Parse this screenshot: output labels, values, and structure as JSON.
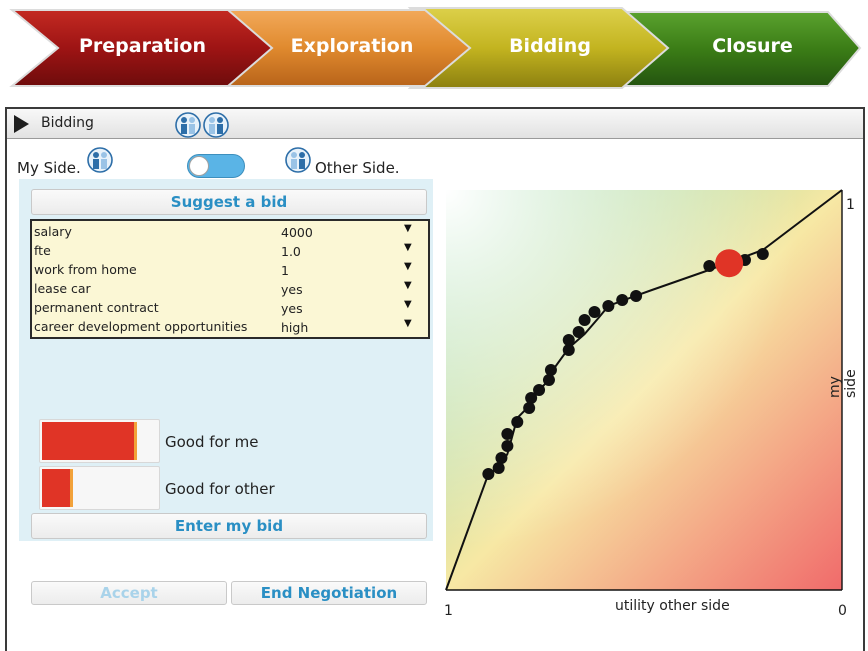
{
  "stages": [
    {
      "label": "Preparation",
      "color": "#a01818"
    },
    {
      "label": "Exploration",
      "color": "#e08a2e"
    },
    {
      "label": "Bidding",
      "color": "#c3b420"
    },
    {
      "label": "Closure",
      "color": "#3b7d16"
    }
  ],
  "panel": {
    "title": "Bidding",
    "my_side_label": "My Side.",
    "other_side_label": "Other Side.",
    "suggest_button": "Suggest a bid",
    "enter_button": "Enter my bid",
    "accept_button": "Accept",
    "end_button": "End Negotiation"
  },
  "issues": [
    {
      "name": "salary",
      "value": "4000"
    },
    {
      "name": "fte",
      "value": "1.0"
    },
    {
      "name": "work from home",
      "value": "1"
    },
    {
      "name": "lease car",
      "value": "yes"
    },
    {
      "name": "permanent contract",
      "value": "yes"
    },
    {
      "name": "career development opportunities",
      "value": "high"
    }
  ],
  "meters": {
    "good_for_me": {
      "label": "Good for me",
      "fraction": 0.83
    },
    "good_for_other": {
      "label": "Good for other",
      "fraction": 0.27
    }
  },
  "chart": {
    "xlabel": "utility other side",
    "ylabel": "my side",
    "x_left_tick": "1",
    "x_right_tick": "0",
    "y_top_tick": "1"
  },
  "chart_data": {
    "type": "scatter",
    "xlabel": "utility other side",
    "ylabel": "my side",
    "x_axis_direction": "reversed",
    "xlim": [
      1,
      0
    ],
    "ylim": [
      0,
      1
    ],
    "frontier": [
      [
        1.0,
        0.0
      ],
      [
        0.893,
        0.29
      ],
      [
        0.867,
        0.305
      ],
      [
        0.845,
        0.34
      ],
      [
        0.82,
        0.43
      ],
      [
        0.79,
        0.46
      ],
      [
        0.765,
        0.5
      ],
      [
        0.74,
        0.525
      ],
      [
        0.73,
        0.55
      ],
      [
        0.69,
        0.605
      ],
      [
        0.65,
        0.64
      ],
      [
        0.615,
        0.68
      ],
      [
        0.59,
        0.71
      ],
      [
        0.55,
        0.725
      ],
      [
        0.48,
        0.75
      ],
      [
        0.35,
        0.795
      ],
      [
        0.2,
        0.85
      ],
      [
        0.0,
        1.0
      ]
    ],
    "bids": [
      [
        0.893,
        0.29
      ],
      [
        0.867,
        0.305
      ],
      [
        0.86,
        0.33
      ],
      [
        0.845,
        0.36
      ],
      [
        0.845,
        0.39
      ],
      [
        0.82,
        0.42
      ],
      [
        0.79,
        0.455
      ],
      [
        0.785,
        0.48
      ],
      [
        0.765,
        0.5
      ],
      [
        0.74,
        0.525
      ],
      [
        0.735,
        0.55
      ],
      [
        0.69,
        0.6
      ],
      [
        0.69,
        0.625
      ],
      [
        0.665,
        0.645
      ],
      [
        0.65,
        0.675
      ],
      [
        0.625,
        0.695
      ],
      [
        0.59,
        0.71
      ],
      [
        0.555,
        0.725
      ],
      [
        0.52,
        0.735
      ],
      [
        0.335,
        0.81
      ],
      [
        0.295,
        0.815
      ],
      [
        0.245,
        0.825
      ],
      [
        0.2,
        0.84
      ]
    ],
    "current_bid": [
      0.285,
      0.817
    ],
    "colors": {
      "bids": "#111111",
      "current_bid": "#e03426",
      "line": "#111111"
    }
  }
}
